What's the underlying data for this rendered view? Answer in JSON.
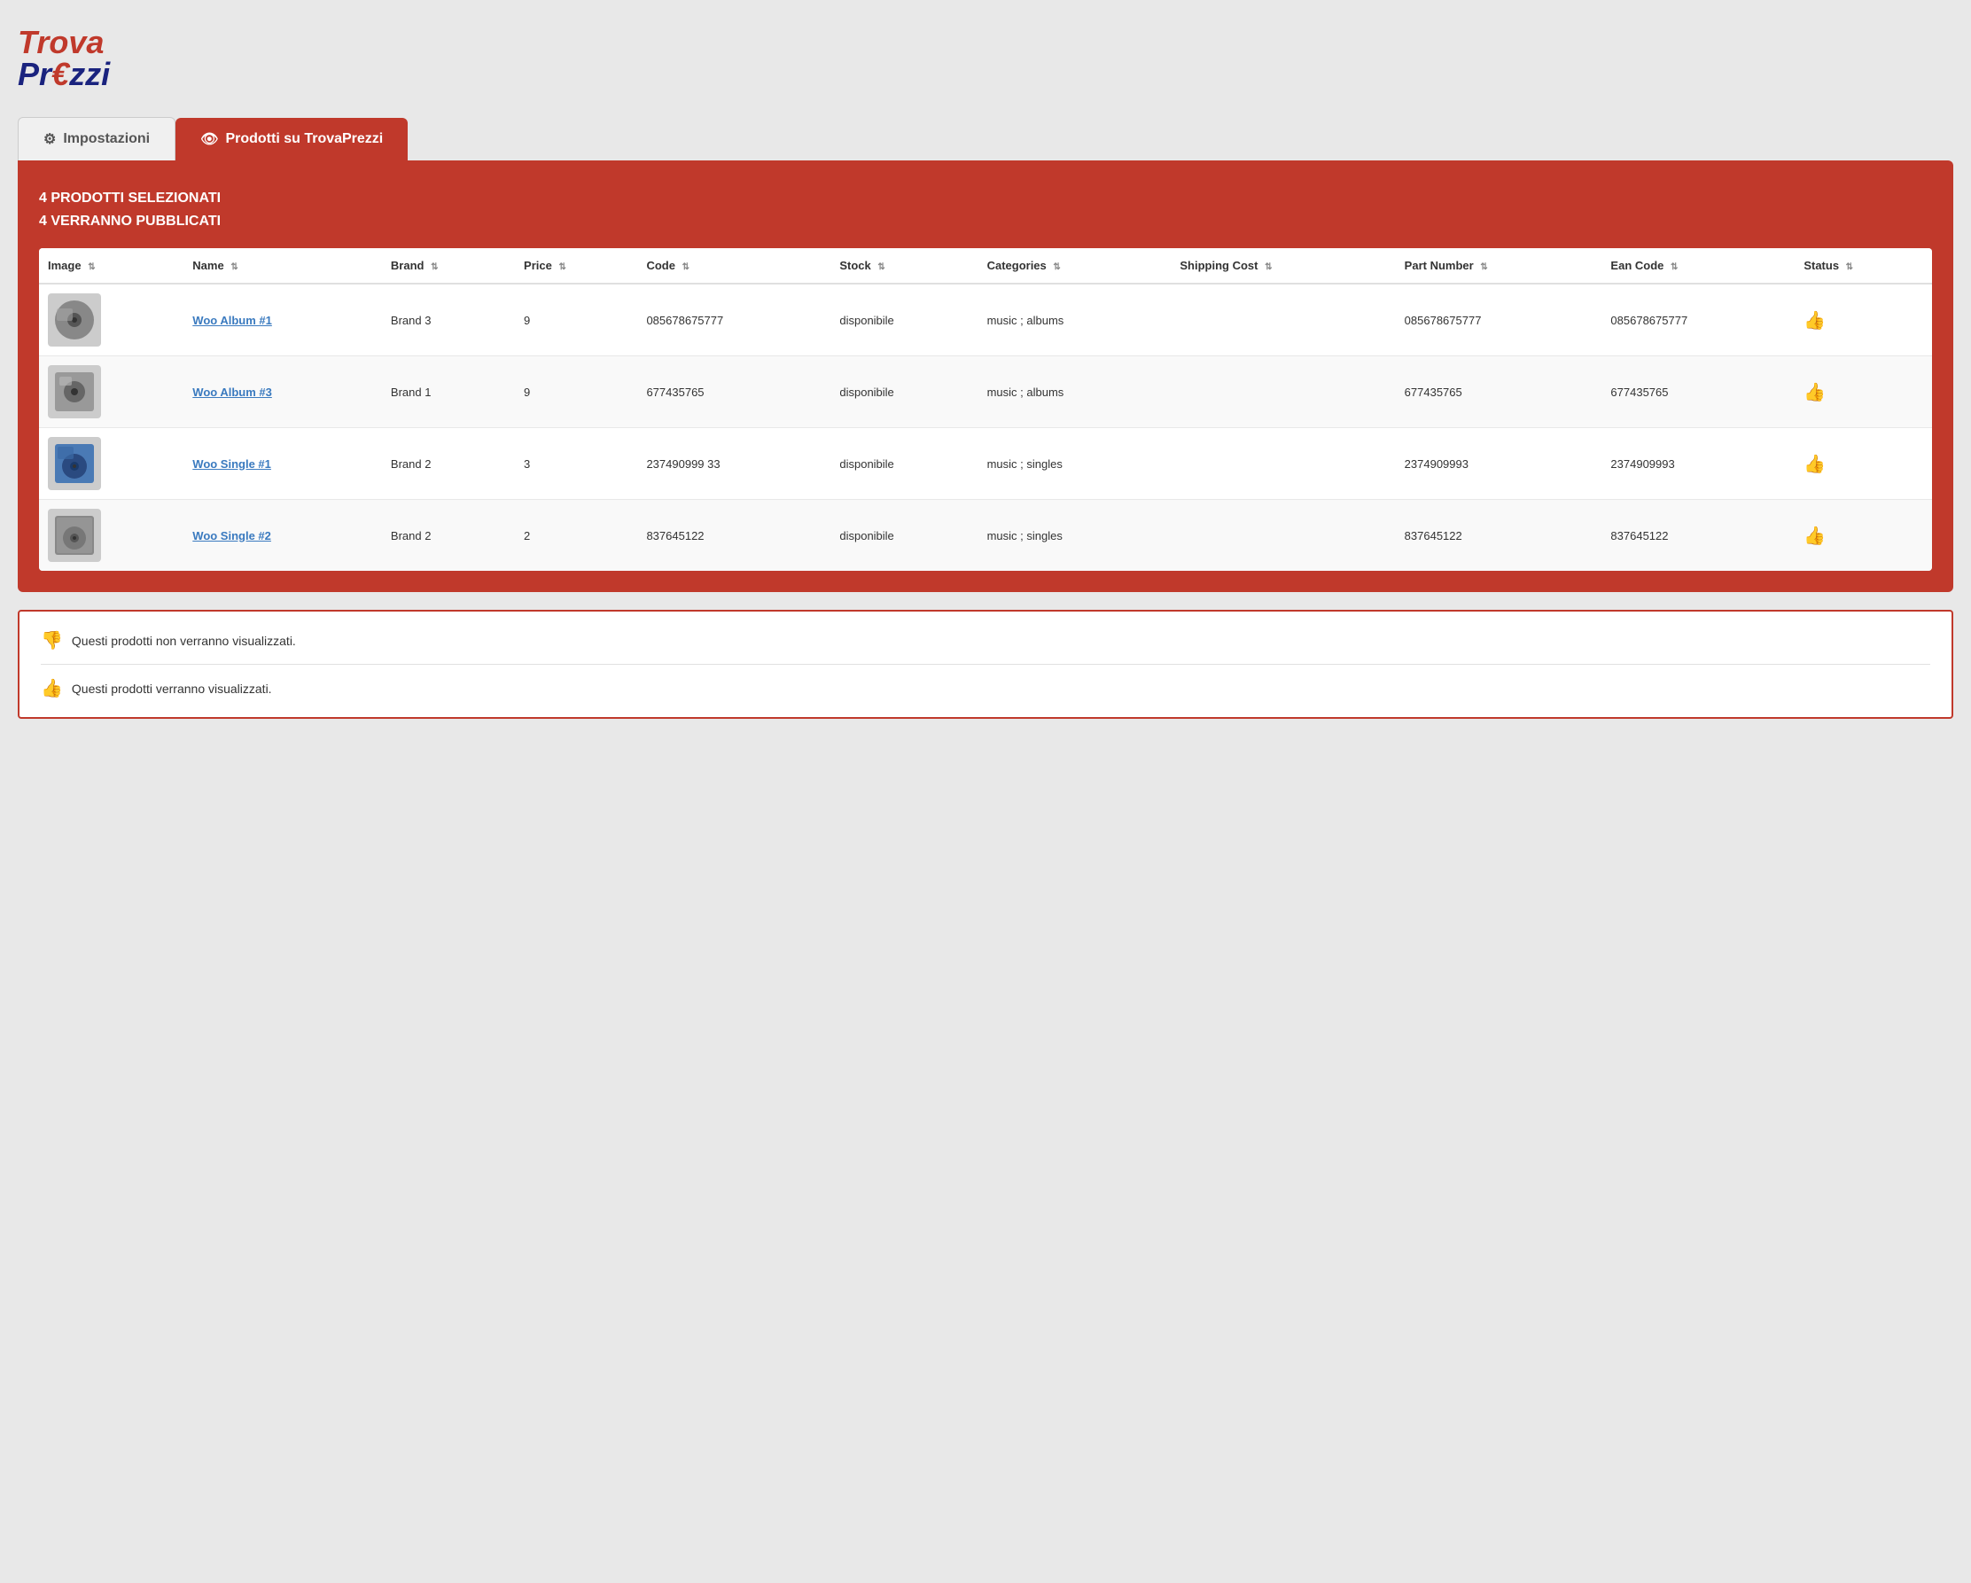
{
  "logo": {
    "trova": "Trova",
    "prezzi": "Pr",
    "euro": "€",
    "prezzi2": "zzi"
  },
  "tabs": [
    {
      "id": "impostazioni",
      "label": "Impostazioni",
      "icon": "gear",
      "active": false
    },
    {
      "id": "prodotti",
      "label": "Prodotti su TrovaPrezzi",
      "icon": "eye",
      "active": true
    }
  ],
  "panel": {
    "selectedCount": "4 PRODOTTI SELEZIONATI",
    "publishedCount": "4 VERRANNO PUBBLICATI"
  },
  "table": {
    "columns": [
      {
        "id": "image",
        "label": "Image"
      },
      {
        "id": "name",
        "label": "Name"
      },
      {
        "id": "brand",
        "label": "Brand"
      },
      {
        "id": "price",
        "label": "Price"
      },
      {
        "id": "code",
        "label": "Code"
      },
      {
        "id": "stock",
        "label": "Stock"
      },
      {
        "id": "categories",
        "label": "Categories"
      },
      {
        "id": "shipping_cost",
        "label": "Shipping Cost"
      },
      {
        "id": "part_number",
        "label": "Part Number"
      },
      {
        "id": "ean_code",
        "label": "Ean Code"
      },
      {
        "id": "status",
        "label": "Status"
      }
    ],
    "rows": [
      {
        "id": 1,
        "name": "Woo Album #1",
        "brand": "Brand 3",
        "price": "9",
        "code": "085678675777",
        "stock": "disponibile",
        "categories": "music ; albums",
        "shipping_cost": "",
        "part_number": "085678675777",
        "ean_code": "085678675777",
        "status": "thumbs-up",
        "img_type": "album1"
      },
      {
        "id": 2,
        "name": "Woo Album #3",
        "brand": "Brand 1",
        "price": "9",
        "code": "677435765",
        "stock": "disponibile",
        "categories": "music ; albums",
        "shipping_cost": "",
        "part_number": "677435765",
        "ean_code": "677435765",
        "status": "thumbs-up",
        "img_type": "album2"
      },
      {
        "id": 3,
        "name": "Woo Single #1",
        "brand": "Brand 2",
        "price": "3",
        "code": "237490999 33",
        "stock": "disponibile",
        "categories": "music ; singles",
        "shipping_cost": "",
        "part_number": "2374909993",
        "ean_code": "2374909993",
        "status": "thumbs-up",
        "img_type": "single1"
      },
      {
        "id": 4,
        "name": "Woo Single #2",
        "brand": "Brand 2",
        "price": "2",
        "code": "837645122",
        "stock": "disponibile",
        "categories": "music ; singles",
        "shipping_cost": "",
        "part_number": "837645122",
        "ean_code": "837645122",
        "status": "thumbs-up",
        "img_type": "single2"
      }
    ]
  },
  "legend": {
    "negative_icon": "thumbs-down",
    "negative_text": "Questi prodotti non verranno visualizzati.",
    "positive_icon": "thumbs-up",
    "positive_text": "Questi prodotti verranno visualizzati."
  }
}
